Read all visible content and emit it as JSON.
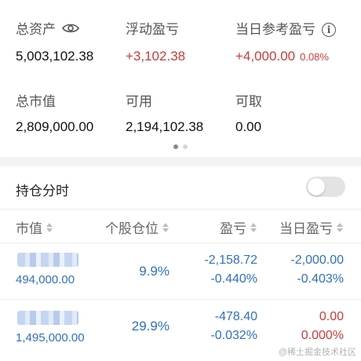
{
  "summary": {
    "total_assets": {
      "label": "总资产",
      "value": "5,003,102.38",
      "icon": "eye-icon"
    },
    "floating_pl": {
      "label": "浮动盈亏",
      "value": "+3,102.38"
    },
    "daily_pl": {
      "label": "当日参考盈亏",
      "value": "+4,000.00",
      "percent": "0.08%",
      "icon": "info-icon"
    },
    "market_value": {
      "label": "总市值",
      "value": "2,809,000.00"
    },
    "available": {
      "label": "可用",
      "value": "2,194,102.38"
    },
    "withdrawable": {
      "label": "可取",
      "value": "0.00"
    }
  },
  "pager": {
    "pages": 2,
    "active": 1
  },
  "position_time": {
    "label": "持仓分时",
    "toggle_on": false
  },
  "table": {
    "headers": [
      "市值",
      "个股仓位",
      "盈亏",
      "当日盈亏"
    ],
    "rows": [
      {
        "market_value": "494,000.00",
        "position": "9.9%",
        "pl": "-2,158.72",
        "pl_pct": "-0.440%",
        "day_pl": "-2,000.00",
        "day_pl_pct": "-0.403%",
        "day_color": "blue"
      },
      {
        "market_value": "1,495,000.00",
        "position": "29.9%",
        "pl": "-478.40",
        "pl_pct": "-0.032%",
        "day_pl": "0.00",
        "day_pl_pct": "0.000%",
        "day_color": "red"
      }
    ]
  },
  "watermark": "@稀土掘金技术社区",
  "colors": {
    "up": "#d13838",
    "down": "#2f6fcd",
    "muted": "#555555"
  }
}
